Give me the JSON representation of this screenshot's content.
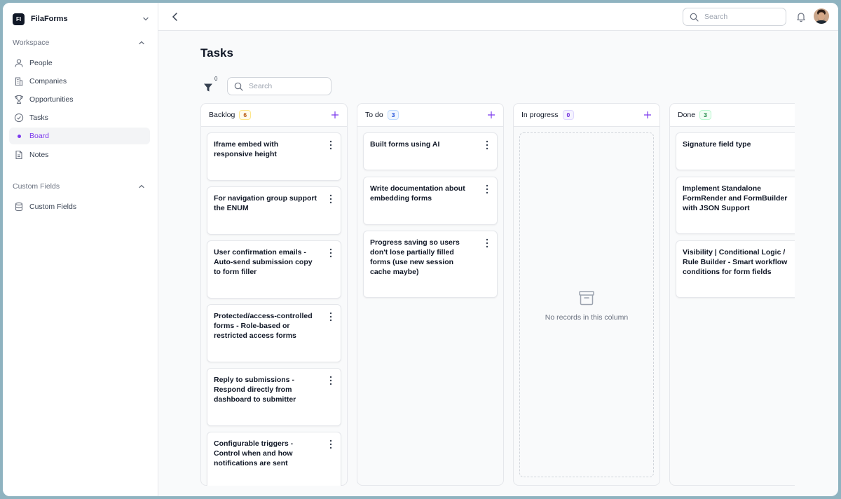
{
  "app": {
    "logo_text": "FI",
    "name": "FilaForms"
  },
  "sidebar": {
    "workspace_label": "Workspace",
    "items": [
      {
        "label": "People",
        "icon": "user-icon"
      },
      {
        "label": "Companies",
        "icon": "building-icon"
      },
      {
        "label": "Opportunities",
        "icon": "trophy-icon"
      },
      {
        "label": "Tasks",
        "icon": "check-circle-icon"
      },
      {
        "label": "Board",
        "icon": "dot-icon",
        "active": true
      },
      {
        "label": "Notes",
        "icon": "document-icon"
      }
    ],
    "custom_fields_label": "Custom Fields",
    "custom_fields_items": [
      {
        "label": "Custom Fields",
        "icon": "database-icon"
      }
    ]
  },
  "topbar": {
    "search_placeholder": "Search"
  },
  "page": {
    "title": "Tasks"
  },
  "toolbar": {
    "filter_count": "0",
    "search_placeholder": "Search"
  },
  "colors": {
    "accent": "#7c3aed"
  },
  "columns": [
    {
      "title": "Backlog",
      "count": "6",
      "badge_color": "#d97706",
      "cards": [
        "Iframe embed with responsive height",
        "For navigation group support the ENUM",
        "User confirmation emails - Auto-send submission copy to form filler",
        "Protected/access-controlled forms - Role-based or restricted access forms",
        "Reply to submissions - Respond directly from dashboard to submitter",
        "Configurable triggers - Control when and how notifications are sent"
      ]
    },
    {
      "title": "To do",
      "count": "3",
      "badge_color": "#2563eb",
      "cards": [
        "Built forms using AI",
        "Write documentation about embedding forms",
        "Progress saving so users don't lose partially filled forms (use new session cache maybe)"
      ]
    },
    {
      "title": "In progress",
      "count": "0",
      "badge_color": "#7c3aed",
      "cards": [],
      "empty_text": "No records in this column"
    },
    {
      "title": "Done",
      "count": "3",
      "badge_color": "#16a34a",
      "cards": [
        "Signature field type",
        "Implement Standalone FormRender and FormBuilder with JSON Support",
        "Visibility | Conditional Logic / Rule Builder - Smart workflow conditions for form fields"
      ]
    }
  ]
}
